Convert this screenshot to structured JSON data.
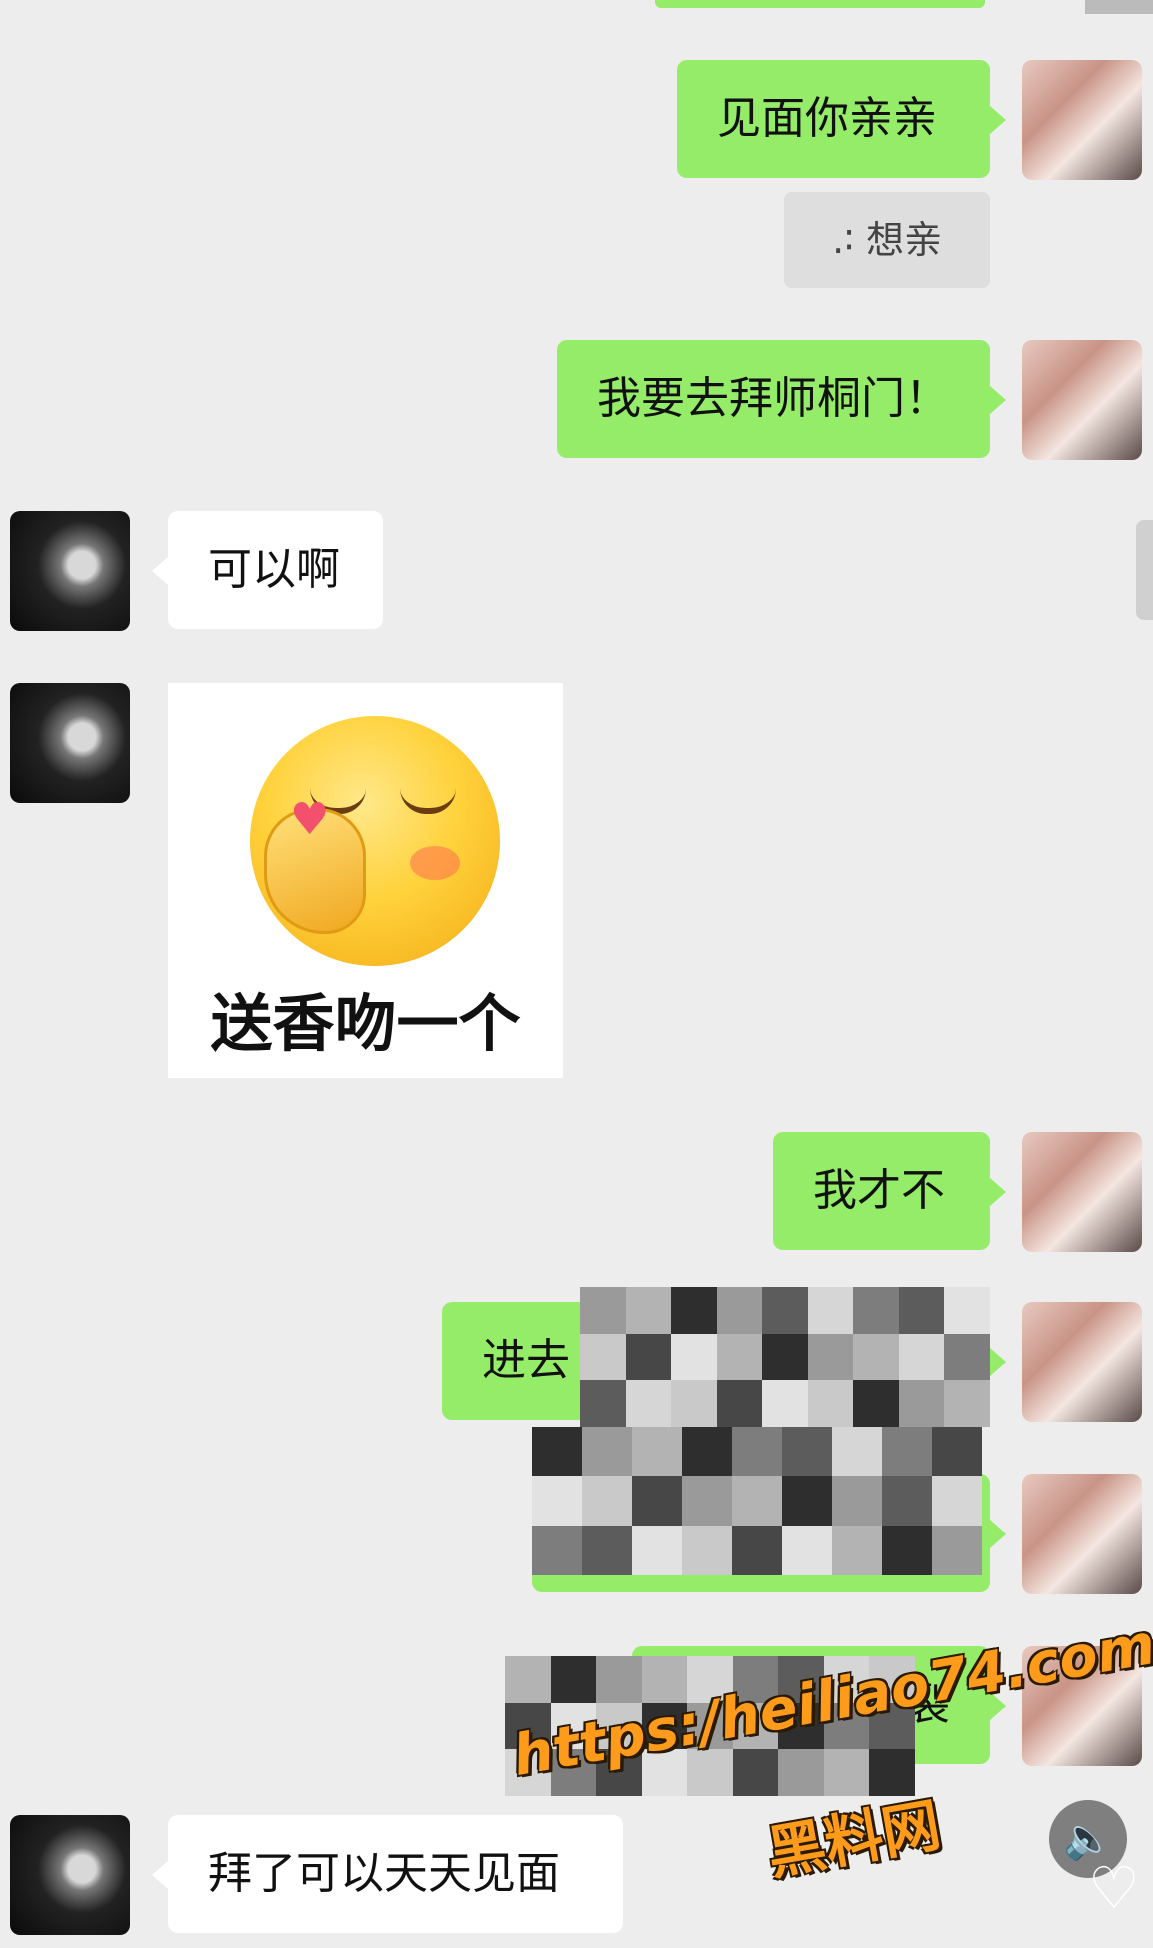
{
  "chat": {
    "messages": [
      {
        "from": "me",
        "text": "见面你亲亲"
      },
      {
        "from": "me",
        "quote": " .∶ 想亲"
      },
      {
        "from": "me",
        "text": "我要去拜师桐门！"
      },
      {
        "from": "other",
        "text": "可以啊"
      },
      {
        "from": "other",
        "sticker_caption": "送香吻一个"
      },
      {
        "from": "me",
        "text": "我才不"
      },
      {
        "from": "me",
        "text_visible": "进去"
      },
      {
        "from": "me",
        "text_visible": "裂"
      },
      {
        "from": "other",
        "text": "拜了可以天天见面"
      }
    ]
  },
  "watermark": {
    "url": "https:/heiliao74.com",
    "name": "黑料网"
  },
  "controls": {
    "voice_icon": "speaker-icon",
    "like_icon": "heart-icon",
    "voice_glyph": "🔈",
    "like_glyph": "♡"
  },
  "colors": {
    "background": "#ededed",
    "my_bubble": "#95ec69",
    "their_bubble": "#ffffff",
    "watermark": "#ff9b1a"
  }
}
